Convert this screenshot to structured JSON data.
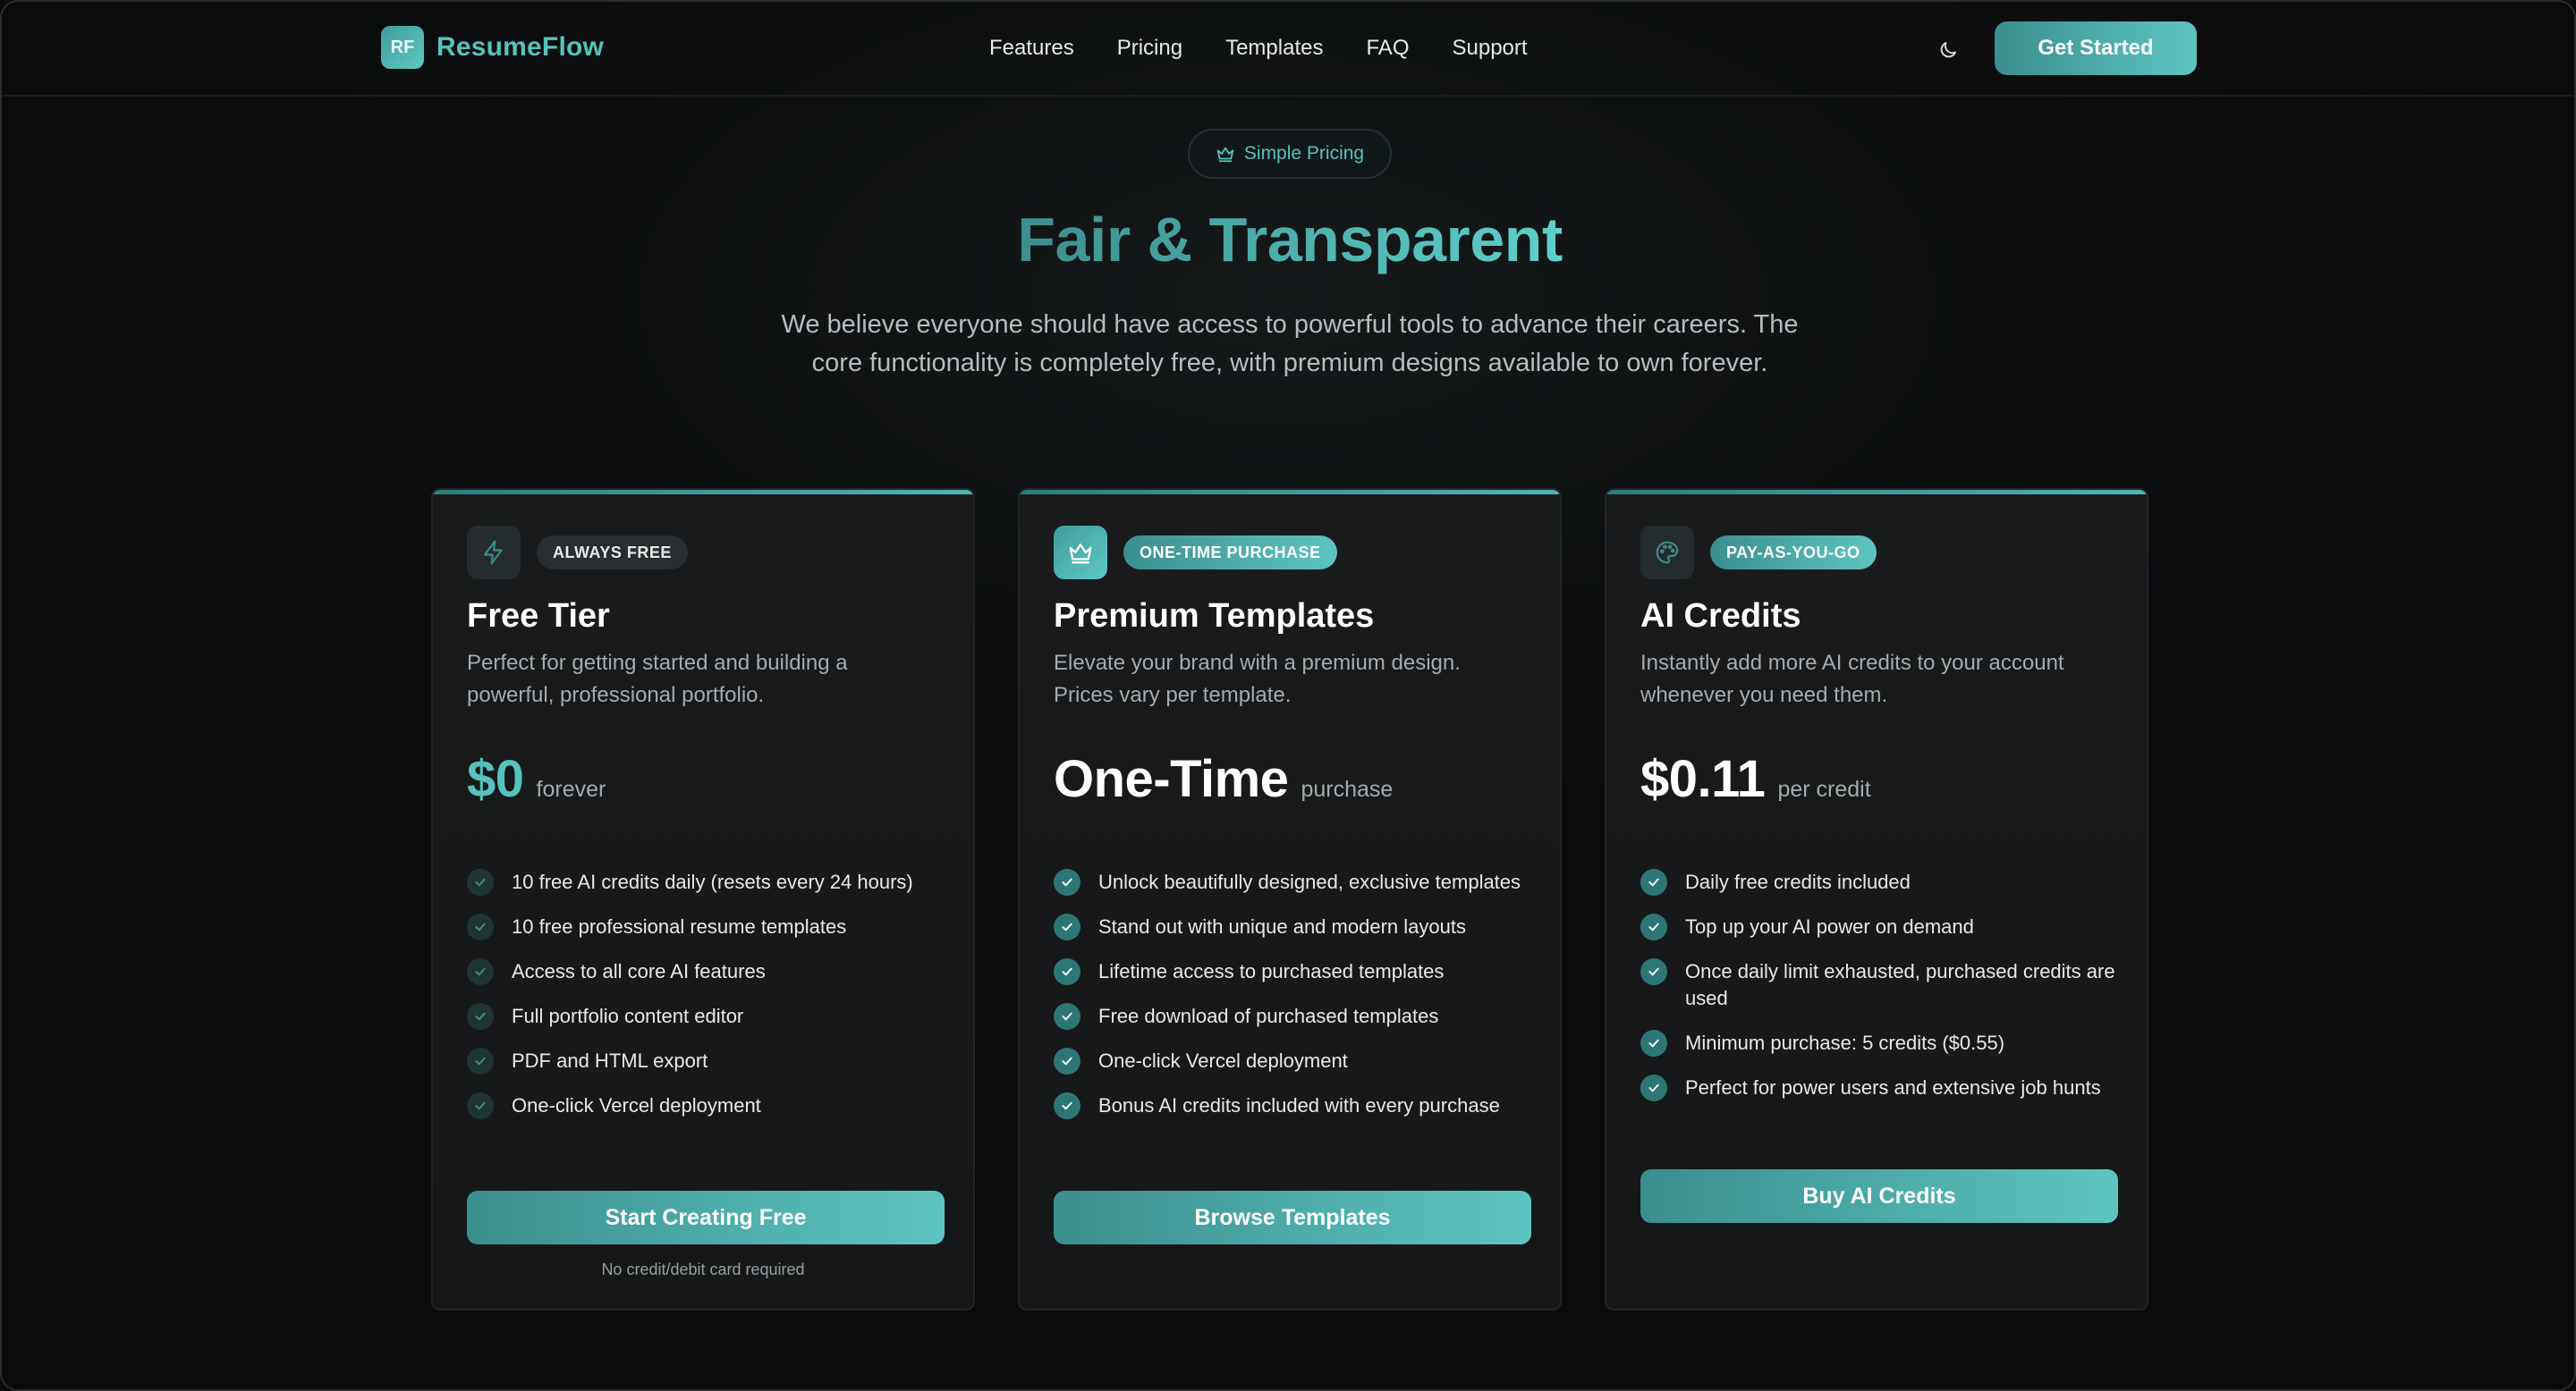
{
  "brand": {
    "mark": "RF",
    "name": "ResumeFlow"
  },
  "nav": {
    "links": [
      "Features",
      "Pricing",
      "Templates",
      "FAQ",
      "Support"
    ],
    "theme_icon": "moon-icon",
    "cta": "Get Started"
  },
  "hero": {
    "pill_icon": "crown-icon",
    "pill": "Simple Pricing",
    "title": "Fair & Transparent",
    "subtitle": "We believe everyone should have access to powerful tools to advance their careers. The core functionality is completely free, with premium designs available to own forever."
  },
  "colors": {
    "accent": "#56c2bc",
    "accent_dark": "#3b8f8d",
    "background": "#0b0c0d",
    "card": "#171a1b"
  },
  "plans": [
    {
      "icon": "lightning-icon",
      "badge": "ALWAYS FREE",
      "title": "Free Tier",
      "description": "Perfect for getting started and building a powerful, professional portfolio.",
      "price": "$0",
      "price_suffix": "forever",
      "features": [
        "10 free AI credits daily (resets every 24 hours)",
        "10 free professional resume templates",
        "Access to all core AI features",
        "Full portfolio content editor",
        "PDF and HTML export",
        "One-click Vercel deployment"
      ],
      "button": "Start Creating Free",
      "note": "No credit/debit card required"
    },
    {
      "icon": "crown-icon",
      "badge": "ONE-TIME PURCHASE",
      "title": "Premium Templates",
      "description": "Elevate your brand with a premium design. Prices vary per template.",
      "price": "One-Time",
      "price_suffix": "purchase",
      "features": [
        "Unlock beautifully designed, exclusive templates",
        "Stand out with unique and modern layouts",
        "Lifetime access to purchased templates",
        "Free download of purchased templates",
        "One-click Vercel deployment",
        "Bonus AI credits included with every purchase"
      ],
      "button": "Browse Templates"
    },
    {
      "icon": "palette-icon",
      "badge": "PAY-AS-YOU-GO",
      "title": "AI Credits",
      "description": "Instantly add more AI credits to your account whenever you need them.",
      "price": "$0.11",
      "price_suffix": "per credit",
      "features": [
        "Daily free credits included",
        "Top up your AI power on demand",
        "Once daily limit exhausted, purchased credits are used",
        "Minimum purchase: 5 credits ($0.55)",
        "Perfect for power users and extensive job hunts"
      ],
      "button": "Buy AI Credits"
    }
  ]
}
